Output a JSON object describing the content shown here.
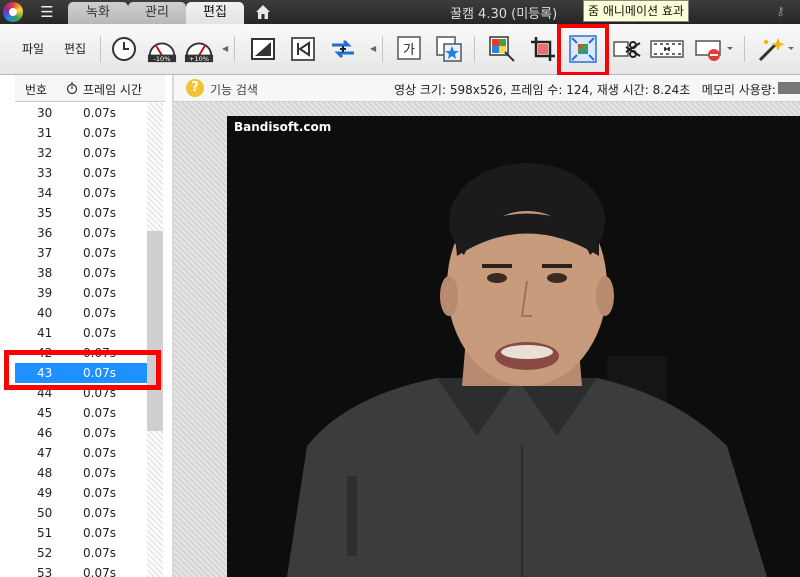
{
  "titlebar": {
    "tabs": [
      "녹화",
      "관리",
      "편집"
    ],
    "active_tab": "편집",
    "app_title": "꿀캠 4.30 (미등록)",
    "tooltip": "줌 애니메이션 효과"
  },
  "toolbar": {
    "file_label": "파일",
    "edit_label": "편집",
    "speed_down_label": "-10%",
    "speed_up_label": "+10%",
    "text_icon_label": "가"
  },
  "frame_list": {
    "col_number": "번호",
    "col_frame_time": "프레임 시간",
    "selected_frame": "43",
    "rows": [
      {
        "num": "30",
        "time": "0.07s"
      },
      {
        "num": "31",
        "time": "0.07s"
      },
      {
        "num": "32",
        "time": "0.07s"
      },
      {
        "num": "33",
        "time": "0.07s"
      },
      {
        "num": "34",
        "time": "0.07s"
      },
      {
        "num": "35",
        "time": "0.07s"
      },
      {
        "num": "36",
        "time": "0.07s"
      },
      {
        "num": "37",
        "time": "0.07s"
      },
      {
        "num": "38",
        "time": "0.07s"
      },
      {
        "num": "39",
        "time": "0.07s"
      },
      {
        "num": "40",
        "time": "0.07s"
      },
      {
        "num": "41",
        "time": "0.07s"
      },
      {
        "num": "42",
        "time": "0.07s"
      },
      {
        "num": "43",
        "time": "0.07s"
      },
      {
        "num": "44",
        "time": "0.07s"
      },
      {
        "num": "45",
        "time": "0.07s"
      },
      {
        "num": "46",
        "time": "0.07s"
      },
      {
        "num": "47",
        "time": "0.07s"
      },
      {
        "num": "48",
        "time": "0.07s"
      },
      {
        "num": "49",
        "time": "0.07s"
      },
      {
        "num": "50",
        "time": "0.07s"
      },
      {
        "num": "51",
        "time": "0.07s"
      },
      {
        "num": "52",
        "time": "0.07s"
      },
      {
        "num": "53",
        "time": "0.07s"
      }
    ]
  },
  "infobar": {
    "search_label": "기능 검색",
    "video_info": "영상 크기: 598x526, 프레임 수: 124, 재생 시간: 8.24초",
    "memory_label": "메모리 사용량:"
  },
  "preview": {
    "watermark": "Bandisoft.com"
  },
  "colors": {
    "highlight": "#ff0000",
    "selection": "#1e90ff",
    "tooltip_bg": "#ffffd8"
  }
}
